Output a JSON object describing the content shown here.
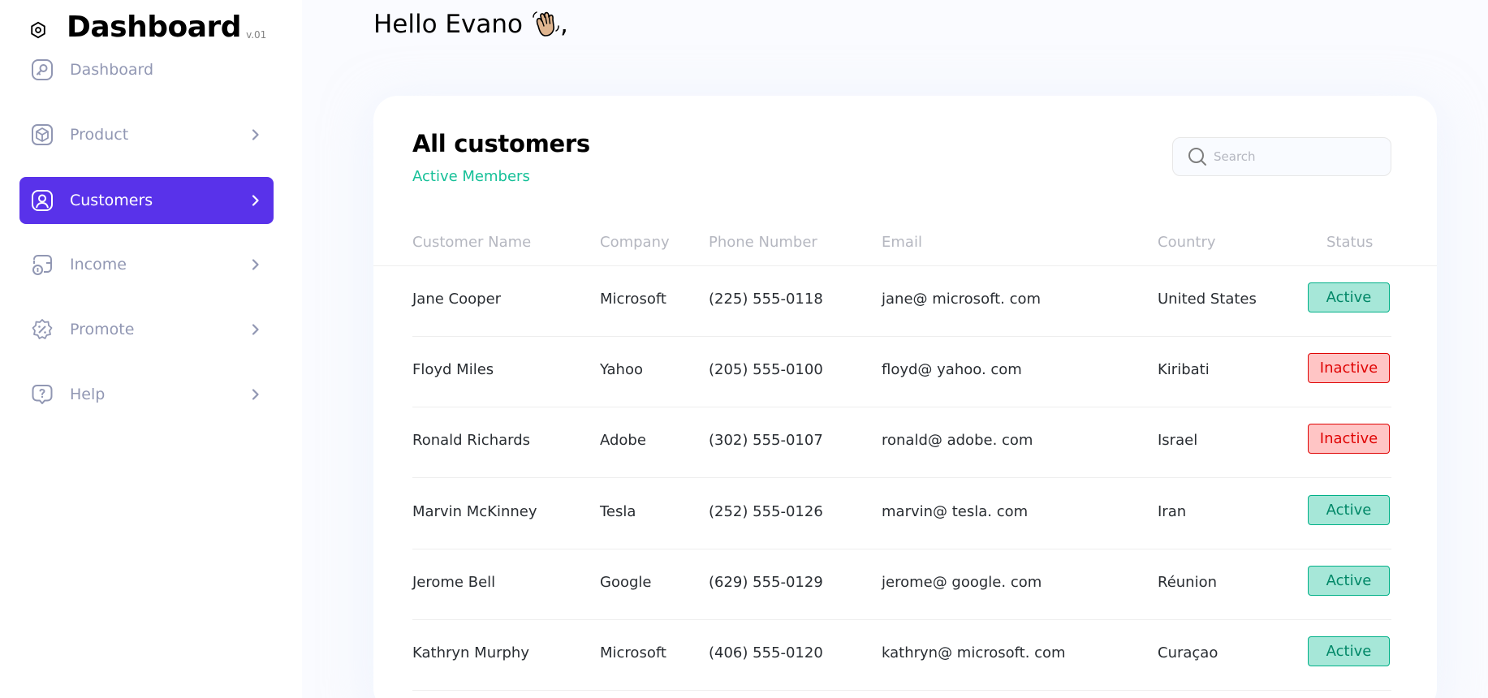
{
  "sidebar": {
    "brand_title": "Dashboard",
    "brand_version": "v.01",
    "items": [
      {
        "label": "Dashboard",
        "icon": "key-square-icon",
        "has_chevron": false,
        "active": false
      },
      {
        "label": "Product",
        "icon": "3d-cube-icon",
        "has_chevron": true,
        "active": false
      },
      {
        "label": "Customers",
        "icon": "user-square-icon",
        "has_chevron": true,
        "active": true
      },
      {
        "label": "Income",
        "icon": "wallet-money-icon",
        "has_chevron": true,
        "active": false
      },
      {
        "label": "Promote",
        "icon": "discount-shape-icon",
        "has_chevron": true,
        "active": false
      },
      {
        "label": "Help",
        "icon": "message-question-icon",
        "has_chevron": true,
        "active": false
      }
    ]
  },
  "header": {
    "greeting": "Hello Evano",
    "greeting_suffix": ",",
    "greeting_icon": "waving-hand-icon"
  },
  "customers_card": {
    "title": "All customers",
    "subtitle": "Active Members",
    "search": {
      "placeholder": "Search",
      "value": ""
    },
    "columns": [
      "Customer Name",
      "Company",
      "Phone Number",
      "Email",
      "Country",
      "Status"
    ],
    "rows": [
      {
        "name": "Jane Cooper",
        "company": "Microsoft",
        "phone": "(225) 555-0118",
        "email": "jane@ microsoft. com",
        "country": "United States",
        "status": "Active"
      },
      {
        "name": "Floyd Miles",
        "company": "Yahoo",
        "phone": "(205) 555-0100",
        "email": "floyd@ yahoo. com",
        "country": "Kiribati",
        "status": "Inactive"
      },
      {
        "name": "Ronald Richards",
        "company": "Adobe",
        "phone": "(302) 555-0107",
        "email": "ronald@ adobe. com",
        "country": "Israel",
        "status": "Inactive"
      },
      {
        "name": "Marvin McKinney",
        "company": "Tesla",
        "phone": "(252) 555-0126",
        "email": "marvin@ tesla. com",
        "country": "Iran",
        "status": "Active"
      },
      {
        "name": "Jerome Bell",
        "company": "Google",
        "phone": "(629) 555-0129",
        "email": "jerome@ google. com",
        "country": "Réunion",
        "status": "Active"
      },
      {
        "name": "Kathryn Murphy",
        "company": "Microsoft",
        "phone": "(406) 555-0120",
        "email": "kathryn@ microsoft. com",
        "country": "Curaçao",
        "status": "Active"
      }
    ]
  },
  "colors": {
    "accent": "#5932ea",
    "active_text": "#008767",
    "active_bg": "#a6e7d8",
    "inactive_text": "#df0404",
    "inactive_bg": "#ffc5c5",
    "subtitle": "#16c098"
  }
}
